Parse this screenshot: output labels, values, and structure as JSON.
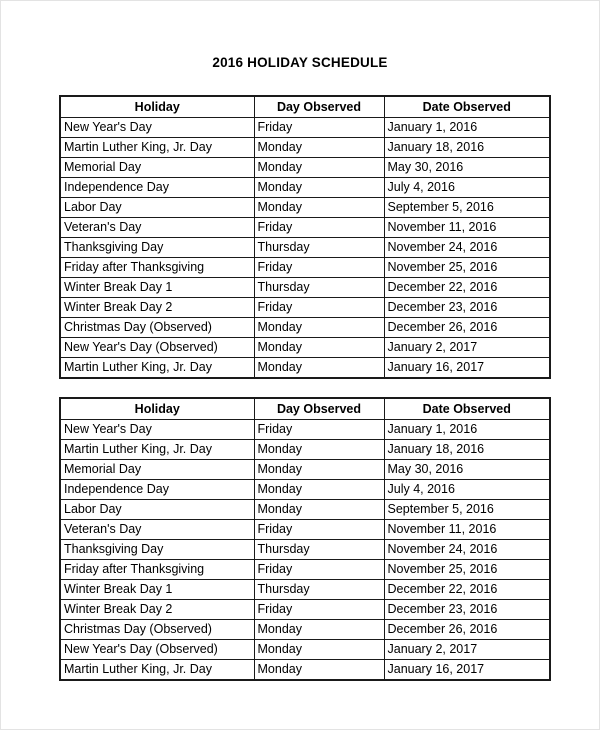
{
  "document": {
    "title": "2016 HOLIDAY SCHEDULE"
  },
  "columns": {
    "holiday": "Holiday",
    "day_observed": "Day Observed",
    "date_observed": "Date Observed"
  },
  "tables": [
    {
      "name": "holiday-schedule-table-1",
      "headers": [
        "Holiday",
        "Day Observed",
        "Date Observed"
      ],
      "rows": [
        [
          "New Year's Day",
          "Friday",
          "January 1, 2016"
        ],
        [
          "Martin Luther King, Jr. Day",
          "Monday",
          "January 18, 2016"
        ],
        [
          "Memorial Day",
          "Monday",
          "May 30, 2016"
        ],
        [
          "Independence Day",
          "Monday",
          "July 4, 2016"
        ],
        [
          "Labor Day",
          "Monday",
          "September 5, 2016"
        ],
        [
          "Veteran's Day",
          "Friday",
          "November 11, 2016"
        ],
        [
          "Thanksgiving Day",
          "Thursday",
          "November 24, 2016"
        ],
        [
          "Friday after Thanksgiving",
          "Friday",
          "November 25, 2016"
        ],
        [
          "Winter Break Day 1",
          "Thursday",
          "December 22, 2016"
        ],
        [
          "Winter Break Day 2",
          "Friday",
          "December 23, 2016"
        ],
        [
          "Christmas Day (Observed)",
          "Monday",
          "December 26, 2016"
        ],
        [
          "New Year's Day (Observed)",
          "Monday",
          "January 2, 2017"
        ],
        [
          "Martin Luther King, Jr. Day",
          "Monday",
          "January 16, 2017"
        ]
      ]
    },
    {
      "name": "holiday-schedule-table-2",
      "headers": [
        "Holiday",
        "Day Observed",
        "Date Observed"
      ],
      "rows": [
        [
          "New Year's Day",
          "Friday",
          "January 1, 2016"
        ],
        [
          "Martin Luther King, Jr. Day",
          "Monday",
          "January 18, 2016"
        ],
        [
          "Memorial Day",
          "Monday",
          "May 30, 2016"
        ],
        [
          "Independence Day",
          "Monday",
          "July 4, 2016"
        ],
        [
          "Labor Day",
          "Monday",
          "September 5, 2016"
        ],
        [
          "Veteran's Day",
          "Friday",
          "November 11, 2016"
        ],
        [
          "Thanksgiving Day",
          "Thursday",
          "November 24, 2016"
        ],
        [
          "Friday after Thanksgiving",
          "Friday",
          "November 25, 2016"
        ],
        [
          "Winter Break Day 1",
          "Thursday",
          "December 22, 2016"
        ],
        [
          "Winter Break Day 2",
          "Friday",
          "December 23, 2016"
        ],
        [
          "Christmas Day (Observed)",
          "Monday",
          "December 26, 2016"
        ],
        [
          "New Year's Day (Observed)",
          "Monday",
          "January 2, 2017"
        ],
        [
          "Martin Luther King, Jr. Day",
          "Monday",
          "January 16, 2017"
        ]
      ]
    }
  ],
  "colors": {
    "page_background": "#ffffff",
    "text": "#000000",
    "table_border": "#1a1a1a",
    "page_edge": "#e3e3e3"
  }
}
